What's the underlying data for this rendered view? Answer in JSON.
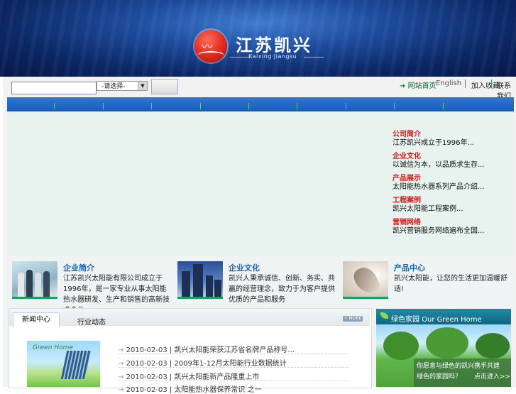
{
  "header": {
    "logo_cn": "江苏凯兴",
    "logo_en": "Kaixing·Jiangsu"
  },
  "search": {
    "input_value": "",
    "select_value": "-请选择-",
    "button_label": ""
  },
  "toplinks": {
    "home": "网站首页",
    "english": "English",
    "link3": "加入收藏",
    "link4": "联系我们"
  },
  "news": [
    {
      "title": "公司简介",
      "text": "江苏凯兴成立于1996年..."
    },
    {
      "title": "企业文化",
      "text": "以诚信为本，以品质求生存..."
    },
    {
      "title": "产品展示",
      "text": "太阳能热水器系列产品介绍..."
    },
    {
      "title": "工程案例",
      "text": "凯兴太阳能工程案例..."
    },
    {
      "title": "营销网络",
      "text": "凯兴营销服务网络遍布全国..."
    }
  ],
  "features": [
    {
      "title": "企业简介",
      "text": "江苏凯兴太阳能有限公司成立于1996年，是一家专业从事太阳能热水器研发、生产和销售的高新技术企业..."
    },
    {
      "title": "企业文化",
      "text": "凯兴人秉承诚信、创新、务实、共赢的经营理念，致力于为客户提供优质的产品和服务"
    },
    {
      "title": "产品中心",
      "text": "凯兴太阳能，让您的生活更加温暖舒适!"
    }
  ],
  "tabs": {
    "active": "新闻中心",
    "second": "行业动态",
    "more": "+ MORE"
  },
  "news_list": [
    {
      "date": "2010-02-03",
      "text": "凯兴太阳能荣获江苏省名牌产品称号..."
    },
    {
      "date": "2010-02-03",
      "text": "2009年1-12月太阳能行业数据统计"
    },
    {
      "date": "2010-02-03",
      "text": "凯兴太阳能新产品隆重上市"
    },
    {
      "date": "2010-02-03",
      "text": "太阳能热水器保养常识 之一"
    }
  ],
  "green_home_caption": "Green Home",
  "side": {
    "title_cn": "绿色家园",
    "title_en": "Our Green Home",
    "line1": "你愿意与绿色的凯兴携手共建",
    "line2": "绿色的家园吗？",
    "link": "点击进入>>"
  }
}
